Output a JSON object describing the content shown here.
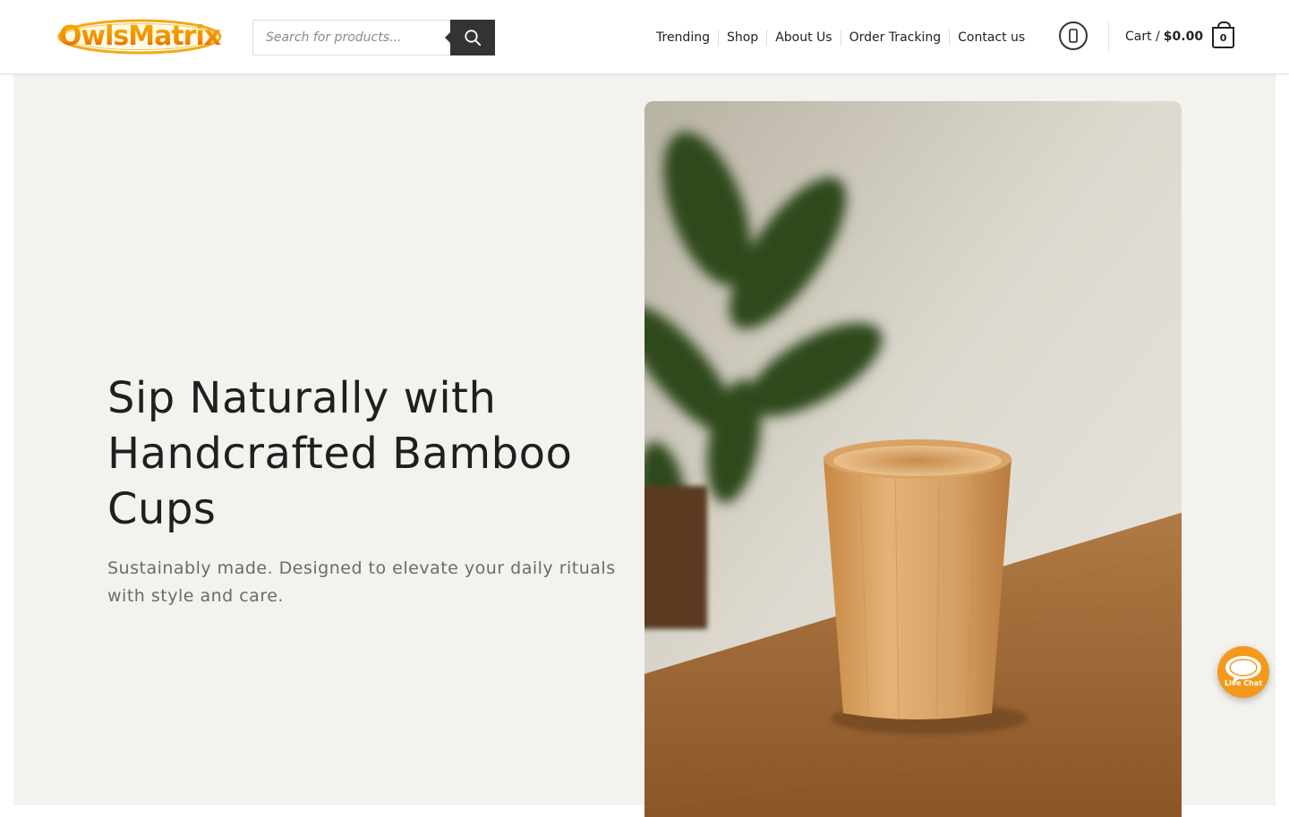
{
  "brand": {
    "logo_text": "OwlsMatrix"
  },
  "search": {
    "placeholder": "Search for products...",
    "value": "",
    "button_icon": "search-icon"
  },
  "nav": {
    "items": [
      {
        "label": "Trending"
      },
      {
        "label": "Shop"
      },
      {
        "label": "About Us"
      },
      {
        "label": "Order Tracking"
      },
      {
        "label": "Contact us"
      }
    ]
  },
  "account": {
    "icon": "user-icon"
  },
  "cart": {
    "label": "Cart /",
    "amount": "$0.00",
    "count": "0",
    "icon": "shopping-bag-icon"
  },
  "hero": {
    "title": "Sip Naturally with Handcrafted Bamboo Cups",
    "subtitle": "Sustainably made. Designed to elevate your daily rituals with style and care.",
    "image_subject": "bamboo cup on wooden table with plant"
  },
  "live_chat": {
    "label": "Live Chat",
    "icon": "chat-bubble-icon"
  },
  "colors": {
    "logo_orange": "#f4a91a",
    "logo_red": "#d62b2b",
    "search_button": "#333333",
    "hero_background": "#f3f2ef",
    "live_chat_orange": "#f39a1d"
  }
}
